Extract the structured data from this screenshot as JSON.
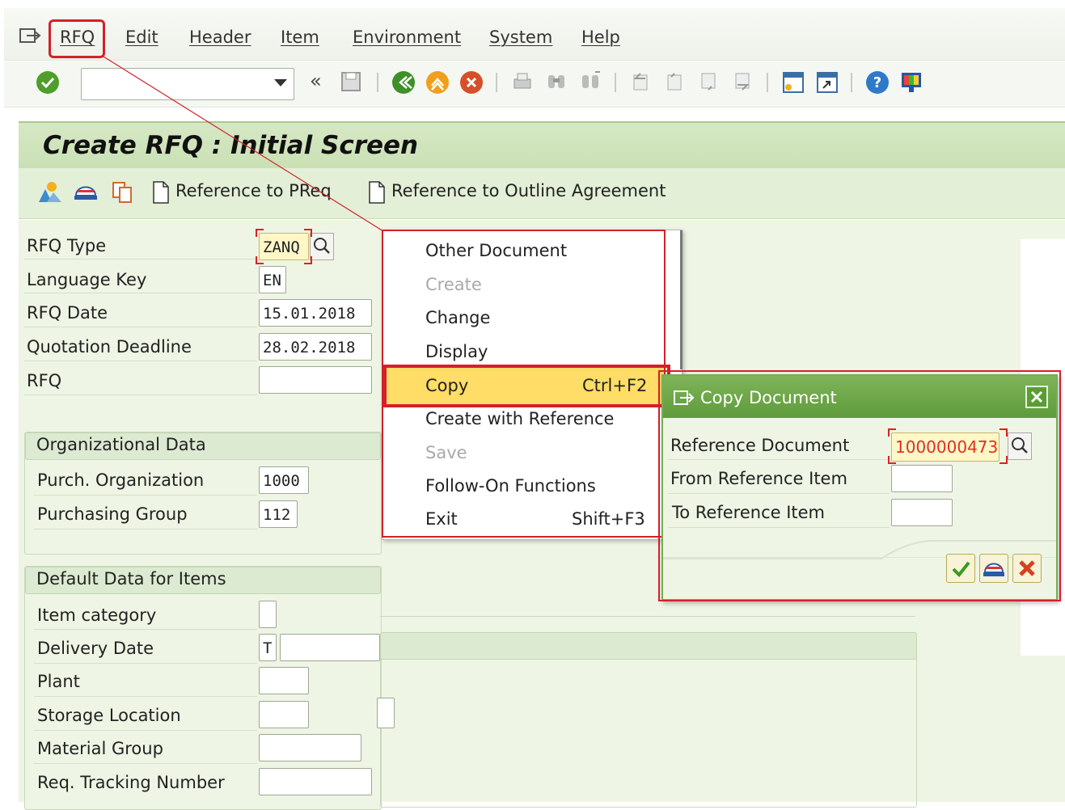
{
  "menu": {
    "items": [
      "RFQ",
      "Edit",
      "Header",
      "Item",
      "Environment",
      "System",
      "Help"
    ]
  },
  "toolbar": {
    "command_field": "",
    "back_glyph": "«"
  },
  "page": {
    "title": "Create RFQ : Initial Screen",
    "app_toolbar": {
      "ref_preq_label": "Reference to PReq",
      "ref_outline_label": "Reference to Outline Agreement"
    }
  },
  "form": {
    "header_fields": [
      {
        "label": "RFQ Type",
        "value": "ZANQ"
      },
      {
        "label": "Language Key",
        "value": "EN"
      },
      {
        "label": "RFQ Date",
        "value": "15.01.2018"
      },
      {
        "label": "Quotation Deadline",
        "value": "28.02.2018"
      },
      {
        "label": "RFQ",
        "value": ""
      }
    ],
    "org_group": {
      "title": "Organizational Data",
      "fields": [
        {
          "label": "Purch. Organization",
          "value": "1000"
        },
        {
          "label": "Purchasing Group",
          "value": "112"
        }
      ]
    },
    "defaults_group": {
      "title": "Default Data for Items",
      "fields": [
        {
          "label": "Item category",
          "value": ""
        },
        {
          "label": "Delivery Date",
          "value": "T"
        },
        {
          "label": "Plant",
          "value": ""
        },
        {
          "label": "Storage Location",
          "value": ""
        },
        {
          "label": "Material Group",
          "value": ""
        },
        {
          "label": "Req. Tracking Number",
          "value": ""
        }
      ]
    }
  },
  "rfq_menu": {
    "items": [
      {
        "label": "Other Document",
        "shortcut": "",
        "enabled": true
      },
      {
        "label": "Create",
        "shortcut": "",
        "enabled": false
      },
      {
        "label": "Change",
        "shortcut": "",
        "enabled": true
      },
      {
        "label": "Display",
        "shortcut": "",
        "enabled": true
      },
      {
        "label": "Copy",
        "shortcut": "Ctrl+F2",
        "enabled": true
      },
      {
        "label": "Create with Reference",
        "shortcut": "",
        "enabled": true
      },
      {
        "label": "Save",
        "shortcut": "",
        "enabled": false
      },
      {
        "label": "Follow-On Functions",
        "shortcut": "",
        "enabled": true
      },
      {
        "label": "Exit",
        "shortcut": "Shift+F3",
        "enabled": true
      }
    ]
  },
  "copy_dialog": {
    "title": "Copy Document",
    "fields": [
      {
        "label": "Reference Document",
        "value": "1000000473"
      },
      {
        "label": "From Reference Item",
        "value": ""
      },
      {
        "label": "To Reference Item",
        "value": ""
      }
    ]
  },
  "colors": {
    "highlight_red": "#d3202a",
    "header_green": "#c9e0b3",
    "dialog_green": "#5e9b3b",
    "menu_highlight": "#ffdd66"
  }
}
